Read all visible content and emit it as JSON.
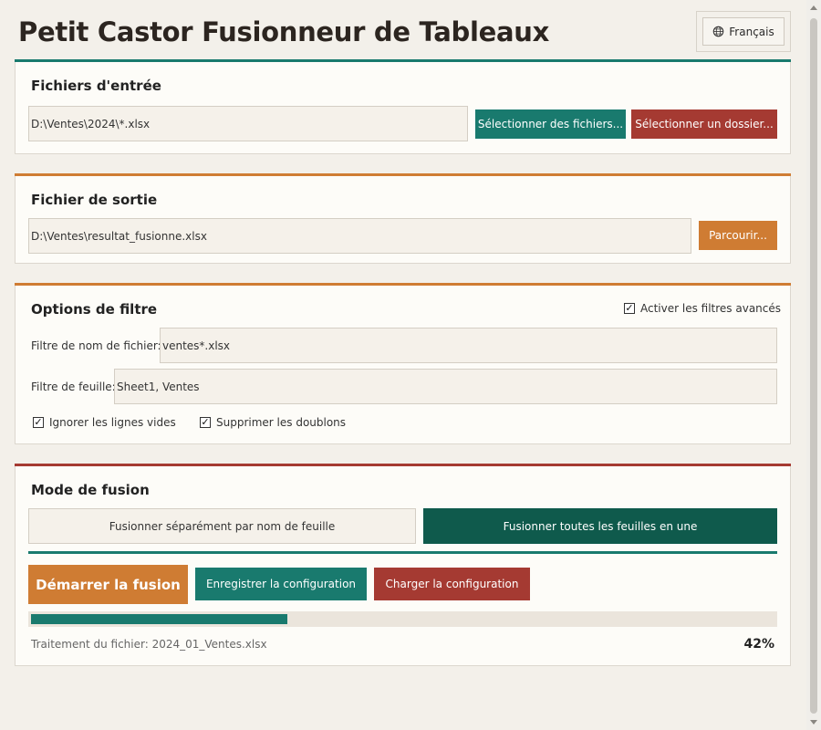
{
  "app": {
    "title": "Petit Castor Fusionneur de Tableaux",
    "language_label": "Français"
  },
  "input_section": {
    "title": "Fichiers d'entrée",
    "path_value": "D:\\Ventes\\2024\\*.xlsx",
    "select_files_label": "Sélectionner des fichiers...",
    "select_folder_label": "Sélectionner un dossier..."
  },
  "output_section": {
    "title": "Fichier de sortie",
    "path_value": "D:\\Ventes\\resultat_fusionne.xlsx",
    "browse_label": "Parcourir..."
  },
  "filter_section": {
    "title": "Options de filtre",
    "advanced_label": "Activer les filtres avancés",
    "advanced_checked": true,
    "filename_filter_label": "Filtre de nom de fichier:",
    "filename_filter_value": "ventes*.xlsx",
    "sheet_filter_label": "Filtre de feuille:",
    "sheet_filter_value": "Sheet1, Ventes",
    "ignore_empty_label": "Ignorer les lignes vides",
    "ignore_empty_checked": true,
    "remove_duplicates_label": "Supprimer les doublons",
    "remove_duplicates_checked": true
  },
  "merge_section": {
    "title": "Mode de fusion",
    "mode_by_sheet_label": "Fusionner séparément par nom de feuille",
    "mode_all_label": "Fusionner toutes les feuilles en une",
    "selected_mode": "all",
    "start_label": "Démarrer la fusion",
    "save_config_label": "Enregistrer la configuration",
    "load_config_label": "Charger la configuration",
    "progress_fraction": 0.42,
    "progress_text": "42%",
    "status_text": "Traitement du fichier: 2024_01_Ventes.xlsx"
  },
  "colors": {
    "teal": "#197a6e",
    "dark_teal": "#0f5a4c",
    "red": "#a53a32",
    "orange": "#cf7c33",
    "background": "#f3f0ea"
  },
  "icons": {
    "language": "globe-icon",
    "checkbox": "check-icon"
  }
}
